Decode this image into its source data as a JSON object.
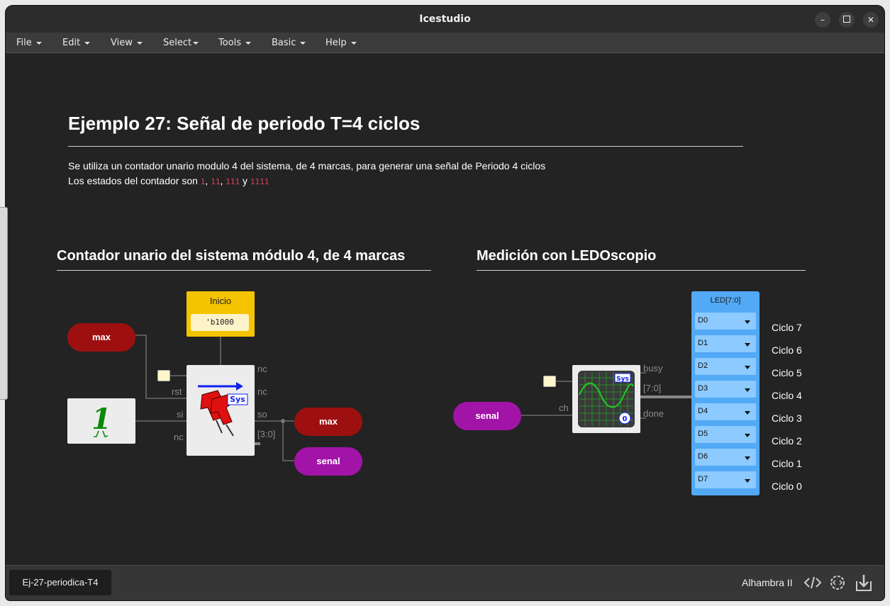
{
  "window": {
    "title": "Icestudio"
  },
  "menu": [
    {
      "label": "File"
    },
    {
      "label": "Edit"
    },
    {
      "label": "View"
    },
    {
      "label": "Select"
    },
    {
      "label": "Tools"
    },
    {
      "label": "Basic"
    },
    {
      "label": "Help"
    }
  ],
  "doc": {
    "title": "Ejemplo 27: Señal de periodo T=4 ciclos",
    "line1": "Se utiliza un contador unario modulo 4 del sistema, de 4 marcas, para generar una señal de Periodo 4 ciclos",
    "line2_prefix": "Los estados del contador son",
    "states": [
      "1",
      "11",
      "111",
      "1111"
    ],
    "sep_comma": ",",
    "sep_and": "y",
    "section_left": "Contador unario del sistema módulo 4, de 4 marcas",
    "section_right": "Medición con LEDOscopio"
  },
  "circuit_left": {
    "input_label": "max",
    "const_value": "1",
    "inicio_title": "Inicio",
    "inicio_value": "'b1000",
    "ports_left": [
      "rst",
      "si",
      "nc"
    ],
    "ports_right": [
      "nc",
      "nc",
      "so",
      "[3:0]"
    ],
    "sys_badge": "Sys",
    "output_max": "max",
    "output_senal": "senal"
  },
  "circuit_right": {
    "input_label": "senal",
    "port_in": "ch",
    "ports_right": [
      "busy",
      "[7:0]",
      "done"
    ],
    "sys_badge": "Sys",
    "zero_badge": "0",
    "led_title": "LED[7:0]",
    "pins": [
      "D0",
      "D1",
      "D2",
      "D3",
      "D4",
      "D5",
      "D6",
      "D7"
    ],
    "ciclos": [
      "Ciclo 7",
      "Ciclo 6",
      "Ciclo 5",
      "Ciclo 4",
      "Ciclo 3",
      "Ciclo 2",
      "Ciclo 1",
      "Ciclo 0"
    ]
  },
  "status": {
    "file_tab": "Ej-27-periodica-T4",
    "board": "Alhambra II",
    "icons": [
      "code-icon",
      "settings-code-icon",
      "download-icon"
    ]
  },
  "colors": {
    "red_pill": "#9e1010",
    "purple_pill": "#a214a8",
    "inicio": "#f5c400",
    "led_block": "#52a9f5"
  }
}
